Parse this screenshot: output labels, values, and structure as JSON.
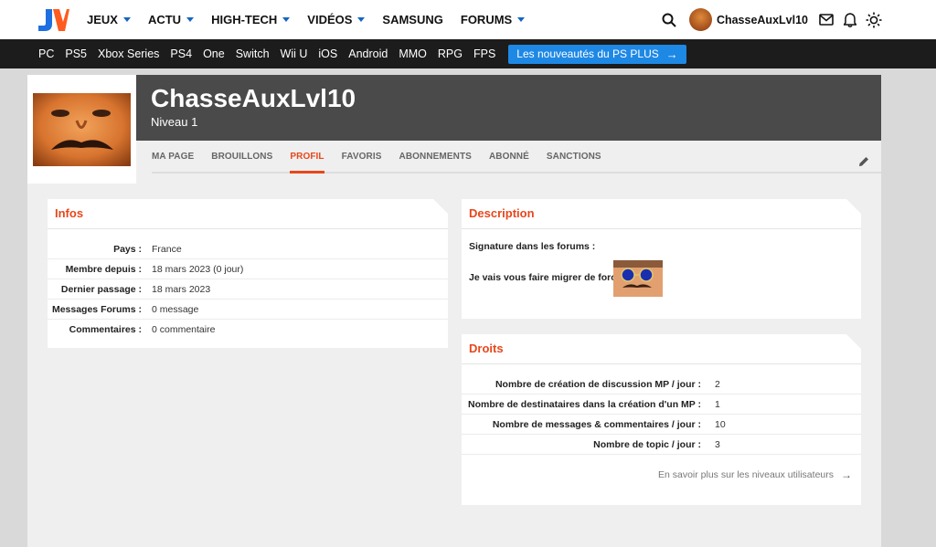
{
  "header": {
    "logo": "JV",
    "nav": [
      {
        "label": "JEUX",
        "dropdown": true
      },
      {
        "label": "ACTU",
        "dropdown": true
      },
      {
        "label": "HIGH-TECH",
        "dropdown": true
      },
      {
        "label": "VIDÉOS",
        "dropdown": true
      },
      {
        "label": "SAMSUNG",
        "dropdown": false
      },
      {
        "label": "FORUMS",
        "dropdown": true
      }
    ],
    "username": "ChasseAuxLvl10",
    "icons": [
      "search-icon",
      "mail-icon",
      "bell-icon",
      "theme-sun-icon"
    ]
  },
  "platforms": [
    "PC",
    "PS5",
    "Xbox Series",
    "PS4",
    "One",
    "Switch",
    "Wii U",
    "iOS",
    "Android",
    "MMO",
    "RPG",
    "FPS"
  ],
  "promo": {
    "label": "Les nouveautés du PS PLUS",
    "color": "#1e88e5"
  },
  "profile": {
    "name": "ChasseAuxLvl10",
    "level": "Niveau 1",
    "tabs": [
      "MA PAGE",
      "BROUILLONS",
      "PROFIL",
      "FAVORIS",
      "ABONNEMENTS",
      "ABONNÉ",
      "SANCTIONS"
    ],
    "active_tab": "PROFIL"
  },
  "infos": {
    "title": "Infos",
    "rows": [
      {
        "label": "Pays :",
        "value": "France"
      },
      {
        "label": "Membre depuis :",
        "value": "18 mars 2023 (0 jour)"
      },
      {
        "label": "Dernier passage :",
        "value": "18 mars 2023"
      },
      {
        "label": "Messages Forums :",
        "value": "0 message"
      },
      {
        "label": "Commentaires :",
        "value": "0 commentaire"
      }
    ]
  },
  "description": {
    "title": "Description",
    "signature_label": "Signature dans les forums :",
    "signature_text": "Je vais vous faire migrer de force"
  },
  "droits": {
    "title": "Droits",
    "rows": [
      {
        "label": "Nombre de création de discussion MP / jour :",
        "value": "2"
      },
      {
        "label": "Nombre de destinataires dans la création d'un MP :",
        "value": "1"
      },
      {
        "label": "Nombre de messages & commentaires / jour :",
        "value": "10"
      },
      {
        "label": "Nombre de topic / jour :",
        "value": "3"
      }
    ],
    "more_link": "En savoir plus sur les niveaux utilisateurs"
  },
  "colors": {
    "accent": "#e8471c",
    "brand_blue": "#1565c0",
    "header_dark": "#4a4a4a",
    "platform_bar": "#1c1c1c"
  }
}
